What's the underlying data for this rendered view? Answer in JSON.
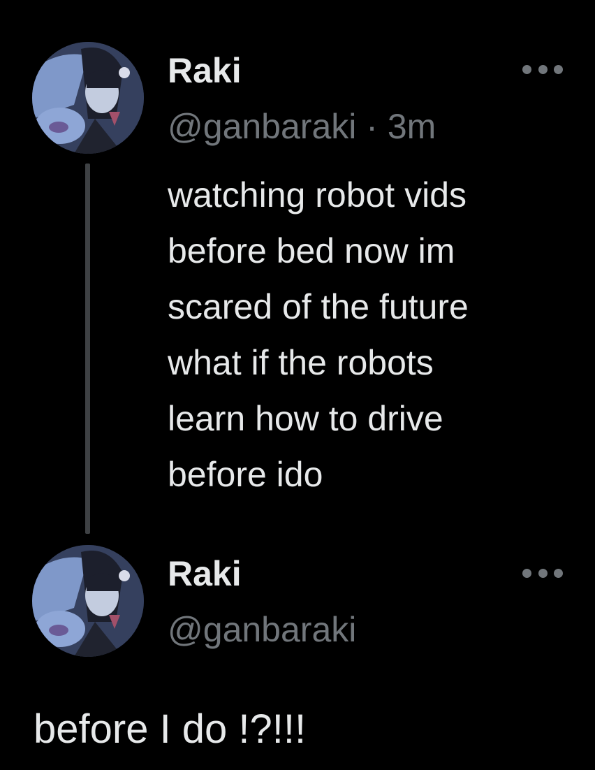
{
  "tweet": {
    "author_name": "Raki",
    "handle": "@ganbaraki",
    "separator": "·",
    "time": "3m",
    "text_lines": [
      "watching robot vids",
      "before bed now im",
      "scared of the future",
      "what if the robots",
      "learn how to drive",
      "before ido"
    ]
  },
  "reply": {
    "author_name": "Raki",
    "handle": "@ganbaraki",
    "text": "before I do !?!!!"
  },
  "icons": {
    "avatar": "profile-avatar-anime-art",
    "more": "more-options-horizontal-dots-icon"
  },
  "colors": {
    "background": "#000000",
    "primary_text": "#e7e9ea",
    "secondary_text": "#71767b",
    "thread_line": "#3e4144"
  }
}
